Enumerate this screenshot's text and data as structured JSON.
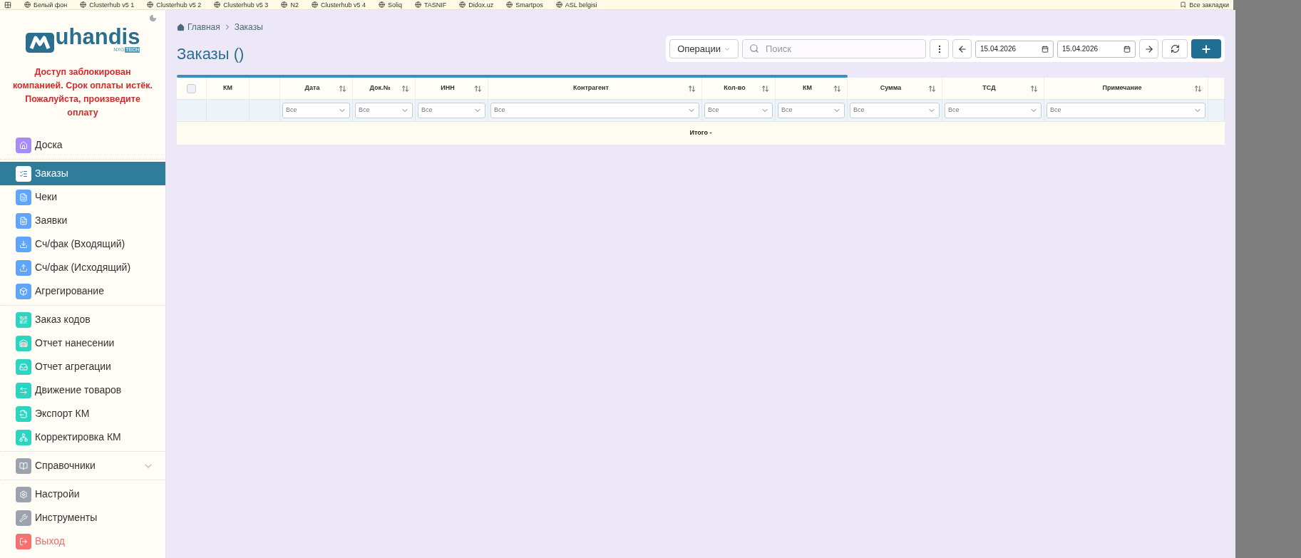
{
  "bookmarks_bar": {
    "items": [
      "Белый фон",
      "Clusterhub v5 1",
      "Clusterhub v5 2",
      "Clusterhub v5 3",
      "N2",
      "Clusterhub v5 4",
      "Soliq",
      "TASNIF",
      "Didox.uz",
      "Smartpos",
      "ASL belgisi"
    ],
    "all_bookmarks": "Все закладки"
  },
  "sidebar": {
    "logo": {
      "text": "uhandis",
      "sub": "NXG",
      "badge": "TECH"
    },
    "alert": "Доступ заблокирован компанией. Срок оплаты истёк. Пожалуйста, произведите оплату",
    "sections": [
      [
        {
          "label": "Доска",
          "kind": "link",
          "selected": false,
          "color": "#a78bfa"
        }
      ],
      [
        {
          "label": "Заказы",
          "kind": "link",
          "selected": true,
          "color": "#ffffff"
        },
        {
          "label": "Чеки",
          "kind": "link",
          "selected": false,
          "color": "#60a5fa"
        },
        {
          "label": "Заявки",
          "kind": "link",
          "selected": false,
          "color": "#60a5fa"
        },
        {
          "label": "Сч/фак (Входящий)",
          "kind": "link",
          "selected": false,
          "color": "#60a5fa"
        },
        {
          "label": "Сч/фак (Исходящий)",
          "kind": "link",
          "selected": false,
          "color": "#60a5fa"
        },
        {
          "label": "Агрегирование",
          "kind": "link",
          "selected": false,
          "color": "#60a5fa"
        }
      ],
      [
        {
          "label": "Заказ кодов",
          "kind": "link",
          "selected": false,
          "color": "#2dd4bf"
        },
        {
          "label": "Отчет нанесении",
          "kind": "link",
          "selected": false,
          "color": "#2dd4bf"
        },
        {
          "label": "Отчет агрегации",
          "kind": "link",
          "selected": false,
          "color": "#2dd4bf"
        },
        {
          "label": "Движение товаров",
          "kind": "link",
          "selected": false,
          "color": "#2dd4bf"
        },
        {
          "label": "Экспорт КМ",
          "kind": "link",
          "selected": false,
          "color": "#2dd4bf"
        },
        {
          "label": "Корректировка КМ",
          "kind": "link",
          "selected": false,
          "color": "#2dd4bf"
        }
      ],
      [
        {
          "label": "Справочники",
          "kind": "group",
          "selected": false,
          "expanded": false,
          "color": "#9ca3af"
        }
      ],
      [
        {
          "label": "Настройи",
          "kind": "link",
          "selected": false,
          "color": "#9ca3af"
        },
        {
          "label": "Инструменты",
          "kind": "link",
          "selected": false,
          "color": "#9ca3af"
        },
        {
          "label": "Выход",
          "kind": "logout",
          "selected": false,
          "color": "#f87171"
        }
      ]
    ]
  },
  "breadcrumb": [
    "Главная",
    "Заказы"
  ],
  "title": "Заказы ()",
  "toolbar": {
    "operations": "Операции",
    "search": {
      "placeholder": "Поиск"
    },
    "date_from": "15.04.2026",
    "date_to": "15.04.2026"
  },
  "table": {
    "level": 0.64,
    "columns": [
      {
        "kind": "checkbox",
        "checked": false
      },
      {
        "kind": "plain",
        "label": "КМ"
      },
      {
        "kind": "blank"
      },
      {
        "kind": "sortable",
        "label": "Дата",
        "filter": "Все"
      },
      {
        "kind": "sortable",
        "label": "Док.№",
        "filter": "Все"
      },
      {
        "kind": "sortable",
        "label": "ИНН",
        "filter": "Все"
      },
      {
        "kind": "sortable",
        "label": "Контрагент",
        "filter": "Все"
      },
      {
        "kind": "sortable",
        "label": "Кол-во",
        "filter": "Все"
      },
      {
        "kind": "sortable",
        "label": "КМ",
        "filter": "Все"
      },
      {
        "kind": "sortable",
        "label": "Сумма",
        "filter": "Все"
      },
      {
        "kind": "sortable",
        "label": "ТСД",
        "filter": "Все"
      },
      {
        "kind": "sortable",
        "label": "Примечание",
        "filter": "Все"
      },
      {
        "kind": "blank"
      }
    ],
    "total": "Итого -"
  }
}
